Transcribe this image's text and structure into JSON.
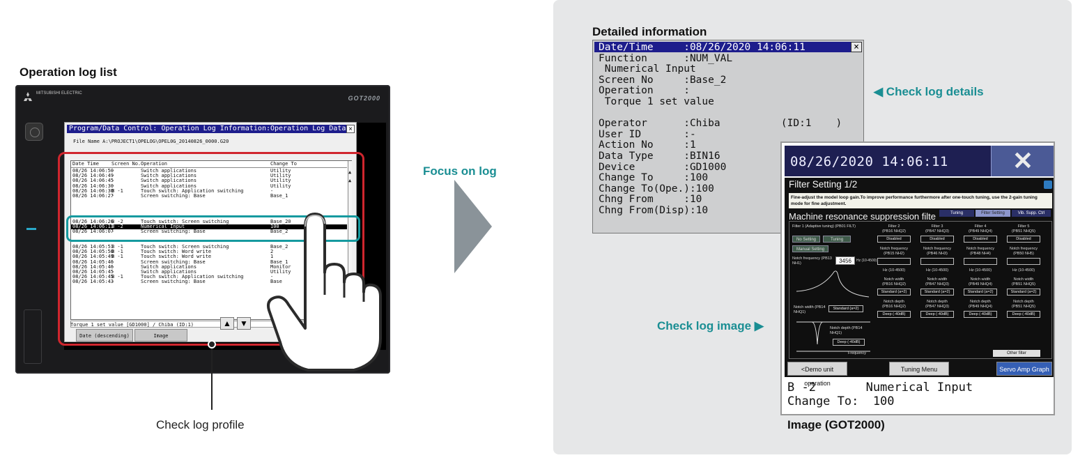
{
  "left": {
    "title": "Operation log list",
    "hmi": {
      "brand": "GOT2000",
      "maker": "MITSUBISHI ELECTRIC"
    },
    "window": {
      "title": "Program/Data Control: Operation Log Information:Operation Log Data List",
      "close": "×",
      "file_label": "File Name  A:\\PROJECT1\\OPELOG\\OPEL0G_20140826_0000.G20",
      "headers": [
        "Date Time",
        "Screen No.",
        "Operation",
        "Change To"
      ],
      "rows": [
        [
          "08/26 14:06:50",
          "-",
          "Switch applications",
          "Utility"
        ],
        [
          "08/26 14:06:49",
          "-",
          "Switch applications",
          "Utility"
        ],
        [
          "08/26 14:06:45",
          "-",
          "Switch applications",
          "Utility"
        ],
        [
          "08/26 14:06:30",
          "-",
          "Switch applications",
          "Utility"
        ],
        [
          "08/26 14:06:30",
          "B -1",
          "Touch switch: Application switching",
          "-"
        ],
        [
          "08/26 14:06:27",
          "-",
          "Screen switching: Base",
          "Base_1"
        ],
        [
          "08/26 14:06:26",
          "B -2",
          "Touch switch: Screen switching",
          "Base_20"
        ],
        [
          "08/26 14:06:11",
          "B -2",
          "Numerical Input",
          "100"
        ],
        [
          "08/26 14:06:07",
          "-",
          "Screen switching: Base",
          "Base_2"
        ],
        [
          "08/26 14:05:51",
          "B -1",
          "Touch switch: Screen switching",
          "Base_2"
        ],
        [
          "08/26 14:05:50",
          "B -1",
          "Touch switch: Word write",
          "2"
        ],
        [
          "08/26 14:05:49",
          "B -1",
          "Touch switch: Word write",
          "1"
        ],
        [
          "08/26 14:05:46",
          "-",
          "Screen switching: Base",
          "Base_1"
        ],
        [
          "08/26 14:05:46",
          "-",
          "Switch applications",
          "Monitor"
        ],
        [
          "08/26 14:05:45",
          "-",
          "Switch applications",
          "Utility"
        ],
        [
          "08/26 14:05:45",
          "B -1",
          "Touch switch: Application switching",
          "-"
        ],
        [
          "08/26 14:05:43",
          "-",
          "Screen switching: Base",
          "Base"
        ]
      ],
      "status": "Torque 1 set value [GD1000] / Chiba (ID:1)",
      "btn_date": "Date (descending)",
      "btn_image": "Image",
      "btn_up": "▲",
      "btn_down": "▼"
    },
    "profile_label": "Check log profile"
  },
  "middle": {
    "focus_label": "Focus on log"
  },
  "right": {
    "detail_title": "Detailed information",
    "detail_close": "×",
    "detail_lines": [
      "Date/Time     :08/26/2020 14:06:11",
      "Function      :NUM_VAL",
      " Numerical Input",
      "Screen No     :Base_2",
      "Operation     :",
      " Torque 1 set value",
      "",
      "Operator      :Chiba          (ID:1    )",
      "User ID       :-",
      "Action No     :1",
      "Data Type     :BIN16",
      "Device        :GD1000",
      "Change To     :100",
      "Change To(Ope.):100",
      "Chng From     :10",
      "Chng From(Disp):10"
    ],
    "check_details": "◀ Check log details",
    "check_image": "Check log image ▶",
    "image_caption": "Image (GOT2000)",
    "image": {
      "datetime": "08/26/2020 14:06:11",
      "close": "✕",
      "filter_title": "Filter Setting 1/2",
      "filter_desc": "Fine-adjust the model loop gain.To improve performance furthermore after one-touch tuning, use the 2-gain tuning mode for fine adjustment.",
      "mrs_title": "Machine resonance suppression filte",
      "tabs": [
        "Tuning",
        "Filter Setting",
        "Vib. Supp. Ctrl"
      ],
      "filter1_label": "Filter 1 (Adaptive tuning) (PB01 FILT)",
      "btn_no_setting": "No Setting",
      "btn_tuning": "Tuning",
      "btn_manual": "Manual Setting",
      "notch_freq_label": "Notch frequency (PB13 NH1)",
      "notch_freq_value": "3456",
      "notch_freq_unit": "Hz (10-4500)",
      "notch_width_label": "Notch width (PB14 NHQ1)",
      "notch_width_value": "Standard (a=2)",
      "notch_depth_label": "Notch depth (PB14 NHQ1)",
      "notch_depth_value": "Deep (-40dB)",
      "frequency_label": "Frequency",
      "filters": [
        {
          "name": "Filter 2",
          "param": "(PB16 NHQ2)",
          "state": "Disabled",
          "nf": "(PB15 NH2)",
          "nw": "(PB16 NHQ2)",
          "nd": "(PB16 NHQ2)"
        },
        {
          "name": "Filter 3",
          "param": "(PB47 NHQ3)",
          "state": "Disabled",
          "nf": "(PB46 NH3)",
          "nw": "(PB47 NHQ3)",
          "nd": "(PB47 NHQ3)"
        },
        {
          "name": "Filter 4",
          "param": "(PB49 NHQ4)",
          "state": "Disabled",
          "nf": "(PB48 NH4)",
          "nw": "(PB49 NHQ4)",
          "nd": "(PB49 NHQ4)"
        },
        {
          "name": "Filter 5",
          "param": "(PB51 NHQ5)",
          "state": "Disabled",
          "nf": "(PB50 NH5)",
          "nw": "(PB51 NHQ5)",
          "nd": "(PB51 NHQ5)"
        }
      ],
      "nf_label": "Notch frequency",
      "nw_label": "Notch width",
      "nd_label": "Notch depth",
      "hz_range": "Hz (10-4500)",
      "std_value": "Standard (a=2)",
      "deep_value": "Deep (-40dB)",
      "other_filter": "Other filter",
      "nav_demo": "<Demo unit operation",
      "nav_tuning": "Tuning Menu",
      "nav_servo": "Servo Amp Graph",
      "line1": "B -2       Numerical Input",
      "line2": "Change To:  100"
    }
  },
  "colors": {
    "accent_teal": "#1a8e93",
    "highlight_red": "#d0262e",
    "title_blue": "#1d1d8c"
  }
}
